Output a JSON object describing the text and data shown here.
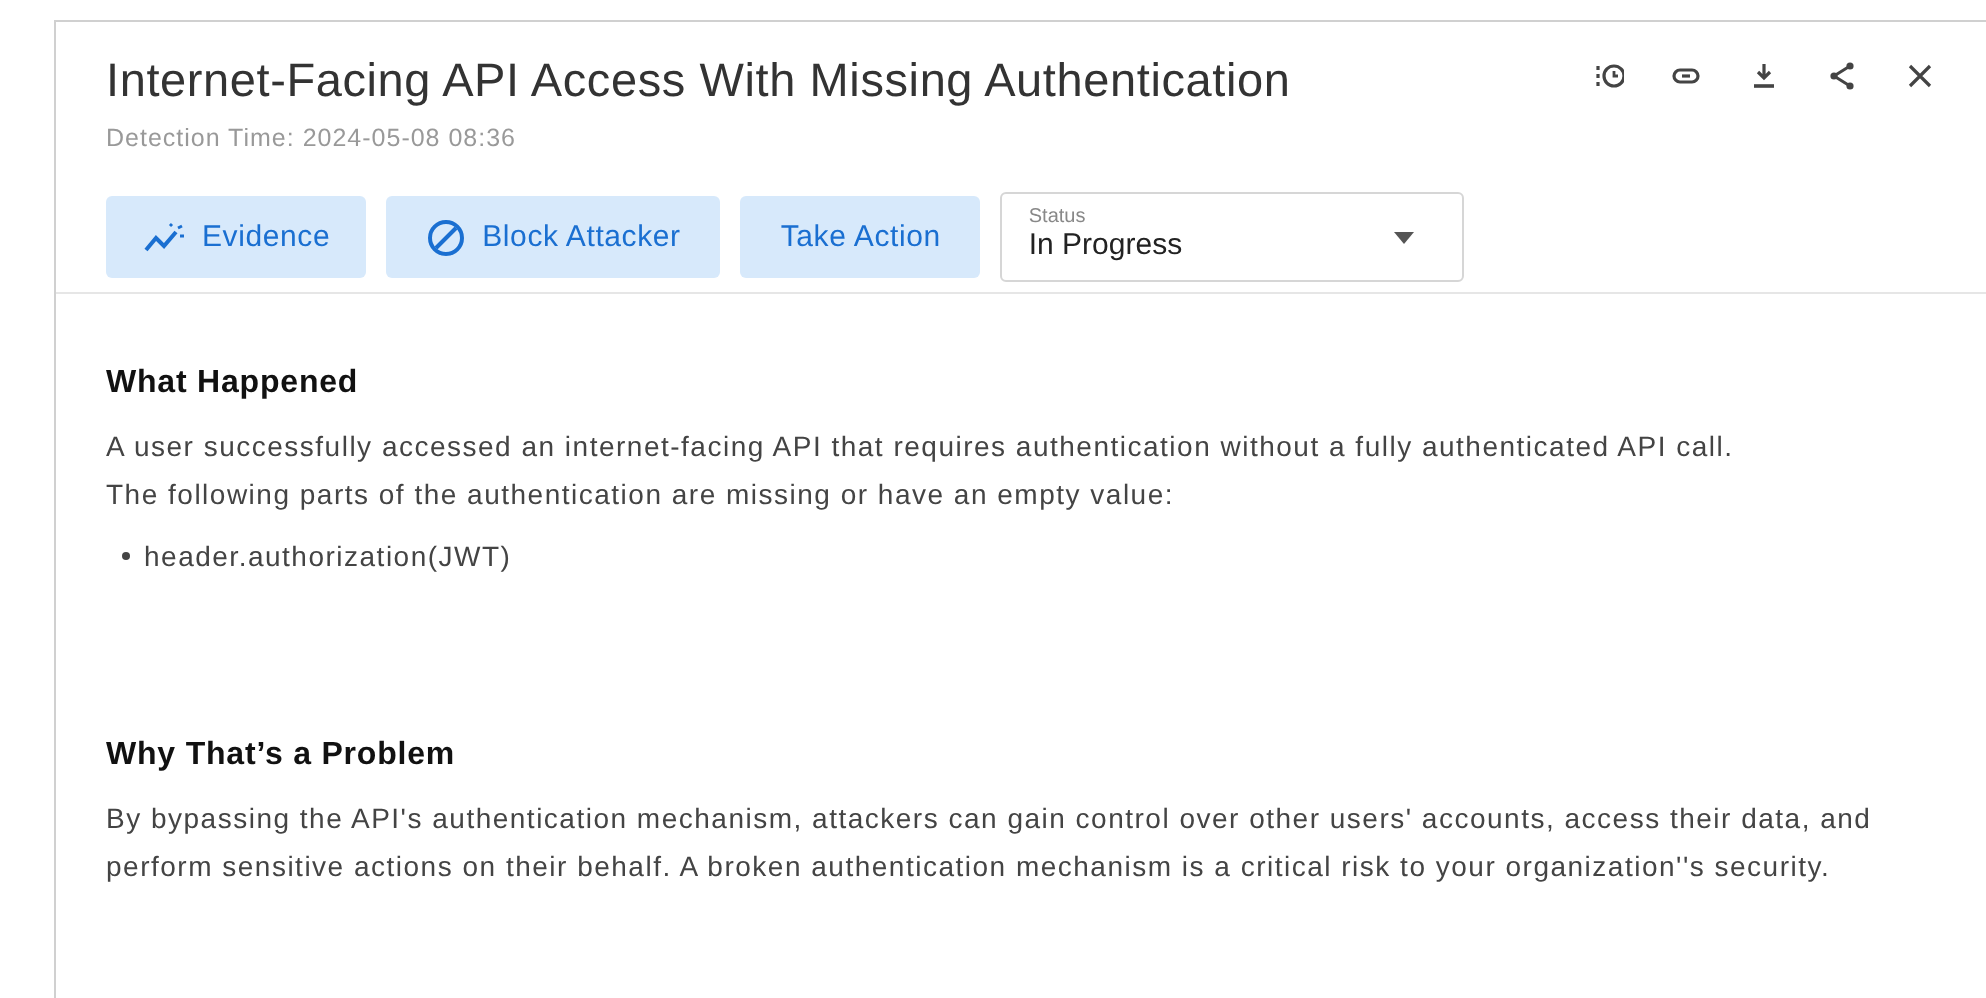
{
  "header": {
    "title": "Internet-Facing API Access With Missing Authentication",
    "detection_time": "Detection Time: 2024-05-08 08:36"
  },
  "actions": [
    {
      "kind": "evidence",
      "label": "Evidence"
    },
    {
      "kind": "block",
      "label": "Block Attacker"
    },
    {
      "kind": "plain",
      "label": "Take Action"
    }
  ],
  "status": {
    "label": "Status",
    "value": "In Progress"
  },
  "sections": [
    {
      "heading": "What Happened",
      "paragraphs": [
        "A user successfully accessed an internet-facing API that requires authentication without a fully authenticated API call.\nThe following parts of the authentication are missing or have an empty value:"
      ],
      "bullets": [
        "header.authorization(JWT)"
      ]
    },
    {
      "heading": "Why That’s a Problem",
      "paragraphs": [
        "By bypassing the API's authentication mechanism, attackers can gain control over other users' accounts, access their data, and perform sensitive actions on their behalf. A broken authentication mechanism is a critical risk to your organization''s security."
      ]
    }
  ]
}
